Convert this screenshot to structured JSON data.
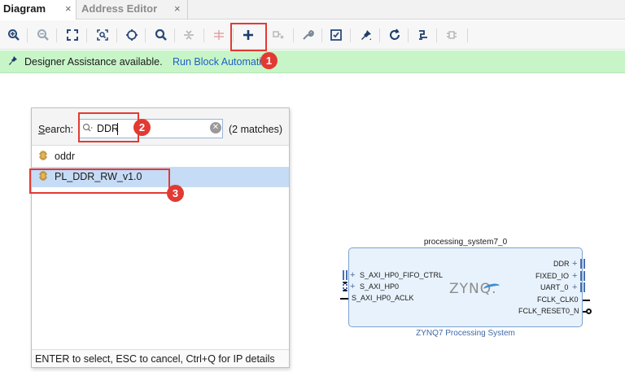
{
  "tabs": [
    {
      "label": "Diagram",
      "active": true,
      "close": "×"
    },
    {
      "label": "Address Editor",
      "active": false,
      "close": "×"
    }
  ],
  "toolbar": {
    "icons": [
      "zoom-in-icon",
      "zoom-out-icon",
      "fit-view-icon",
      "zoom-selection-icon",
      "center-icon",
      "search-icon",
      "collapse-icon",
      "route-icon",
      "add-ip-icon",
      "route-net-icon",
      "wrench-icon",
      "validate-icon",
      "pin-icon",
      "refresh-icon",
      "regenerate-layout-icon",
      "hierarchy-icon"
    ]
  },
  "assist": {
    "message": "Designer Assistance available.",
    "link": "Run Block Automation"
  },
  "annotations": [
    "1",
    "2",
    "3"
  ],
  "search_popup": {
    "label_underlined": "S",
    "label_rest": "earch:",
    "value": "DDR",
    "match_count": "(2 matches)",
    "results": [
      {
        "label": "oddr",
        "selected": false
      },
      {
        "label": "PL_DDR_RW_v1.0",
        "selected": true
      }
    ],
    "footer": "ENTER to select, ESC to cancel, Ctrl+Q for IP details"
  },
  "zynq": {
    "instance_name": "processing_system7_0",
    "logo": "ZYNQ.",
    "subtitle": "ZYNQ7 Processing System",
    "left_ports": [
      "S_AXI_HP0_FIFO_CTRL",
      "S_AXI_HP0",
      "S_AXI_HP0_ACLK"
    ],
    "right_ports": [
      "DDR",
      "FIXED_IO",
      "UART_0",
      "FCLK_CLK0",
      "FCLK_RESET0_N"
    ]
  },
  "colors": {
    "assist_bg": "#c8f5c8",
    "link": "#1f5fc4",
    "annotation_red": "#e23a33",
    "selection": "#c6dbf5",
    "block_fill": "#e8f2fc"
  }
}
